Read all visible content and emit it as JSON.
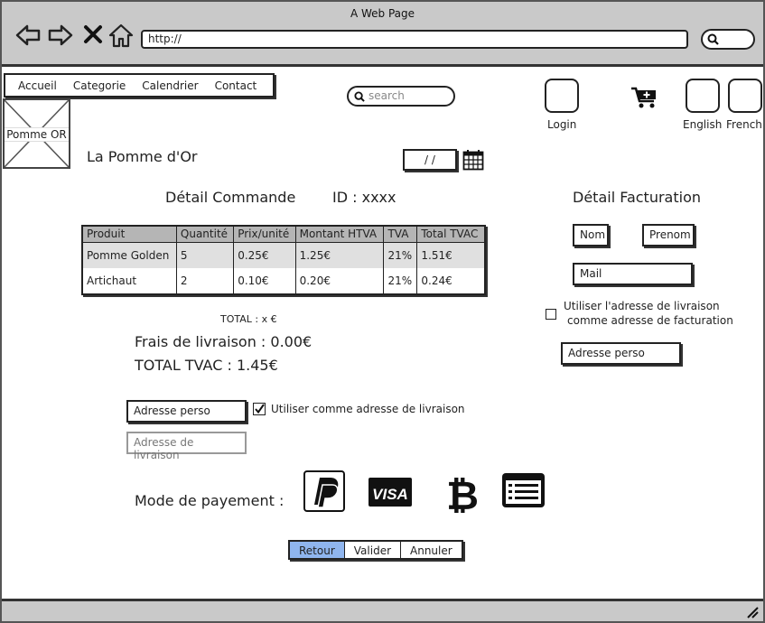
{
  "window": {
    "title": "A Web Page",
    "url": "http://"
  },
  "menu": {
    "items": [
      "Accueil",
      "Categorie",
      "Calendrier",
      "Contact"
    ]
  },
  "search": {
    "placeholder": "search"
  },
  "header": {
    "login": "Login",
    "english": "English",
    "french": "French"
  },
  "logo": {
    "label": "Pomme OR"
  },
  "shop": {
    "name": "La Pomme d'Or",
    "date": "/ /"
  },
  "order": {
    "title": "Détail Commande",
    "id": "ID : xxxx",
    "columns": [
      "Produit",
      "Quantité",
      "Prix/unité",
      "Montant HTVA",
      "TVA",
      "Total TVAC"
    ],
    "rows": [
      [
        "Pomme Golden",
        "5",
        "0.25€",
        "1.25€",
        "21%",
        "1.51€"
      ],
      [
        "Artichaut",
        "2",
        "0.10€",
        "0.20€",
        "21%",
        "0.24€"
      ]
    ],
    "total": "TOTAL : x €",
    "shipping": "Frais de livraison : 0.00€",
    "grand_total": "TOTAL TVAC : 1.45€"
  },
  "billing": {
    "title": "Détail Facturation",
    "nom": "Nom",
    "prenom": "Prenom",
    "mail": "Mail",
    "use_delivery_line1": "Utiliser l'adresse de livraison",
    "use_delivery_line2": "comme adresse de facturation",
    "address": "Adresse perso"
  },
  "delivery": {
    "address": "Adresse perso",
    "use_as_delivery": "Utiliser comme adresse de livraison",
    "delivery_address": "Adresse de livraison"
  },
  "payment": {
    "label": "Mode de payement :",
    "methods": [
      "paypal-icon",
      "visa-icon",
      "bitcoin-icon",
      "card-list-icon"
    ]
  },
  "actions": {
    "back": "Retour",
    "validate": "Valider",
    "cancel": "Annuler"
  }
}
